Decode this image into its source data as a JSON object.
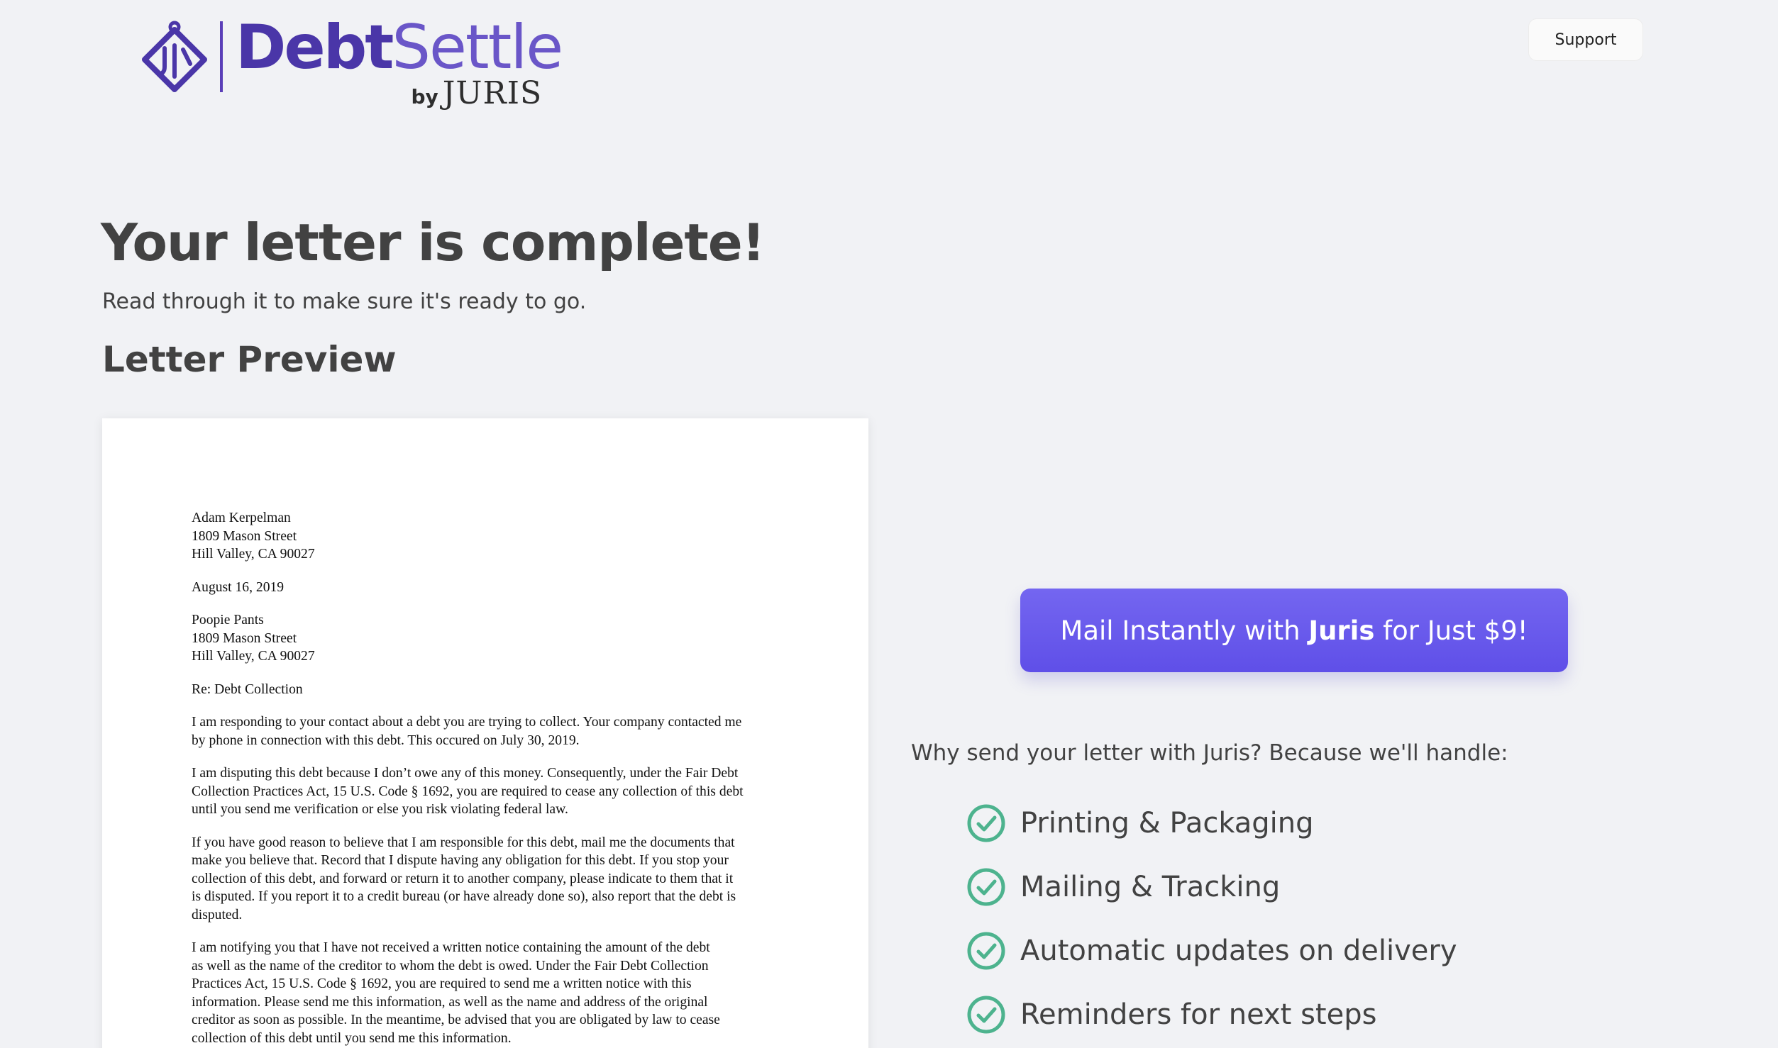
{
  "header": {
    "brand_bold": "Debt",
    "brand_light": "Settle",
    "by": "by",
    "juris": "JURIS",
    "support_label": "Support"
  },
  "main": {
    "title": "Your letter is complete!",
    "subtitle": "Read through it to make sure it's ready to go.",
    "preview_heading": "Letter Preview"
  },
  "letter": {
    "sender": [
      "Adam Kerpelman",
      "1809 Mason Street",
      "Hill Valley, CA 90027"
    ],
    "date": "August 16, 2019",
    "recipient": [
      "Poopie Pants",
      "1809 Mason Street",
      "Hill Valley, CA 90027"
    ],
    "re": "Re: Debt Collection",
    "paragraphs": [
      [
        "I am responding to your contact about a debt you are trying to collect. Your company contacted me",
        "by phone in connection with this debt. This occured on July 30, 2019."
      ],
      [
        "I am disputing this debt because I don’t owe any of this money. Consequently, under the Fair Debt",
        "Collection Practices Act, 15 U.S. Code § 1692, you are required to cease any collection of this debt",
        "until you send me verification or else you risk violating federal law."
      ],
      [
        "If you have good reason to believe that I am responsible for this debt, mail me the documents that",
        "make you believe that. Record that I dispute having any obligation for this debt. If you stop your",
        "collection of this debt, and forward or return it to another company, please indicate to them that it",
        "is disputed. If you report it to a credit bureau (or have already done so), also report that the debt is",
        "disputed."
      ],
      [
        "I am notifying you that I have not received a written notice containing the amount of the debt",
        "as well as the name of the creditor to whom the debt is owed. Under the Fair Debt Collection",
        "Practices Act, 15 U.S. Code § 1692, you are required to send me a written notice with this",
        "information. Please send me this information, as well as the name and address of the original",
        "creditor as soon as possible. In the meantime, be advised that you are obligated by law to cease",
        "collection of this debt until you send me this information."
      ]
    ]
  },
  "cta": {
    "mail_prefix": "Mail Instantly with ",
    "mail_brand": "Juris",
    "mail_suffix": " for Just $9!"
  },
  "why": {
    "heading": "Why send your letter with Juris? Because we'll handle:",
    "features": [
      "Printing & Packaging",
      "Mailing & Tracking",
      "Automatic updates on delivery",
      "Reminders for next steps"
    ]
  },
  "colors": {
    "accent": "#6557ee",
    "brand": "#4a36a8",
    "check": "#4db38e",
    "background": "#f1f2f5"
  },
  "icons": {
    "logo": "juris-diamond-logo-icon",
    "feature": "check-circle-icon"
  }
}
